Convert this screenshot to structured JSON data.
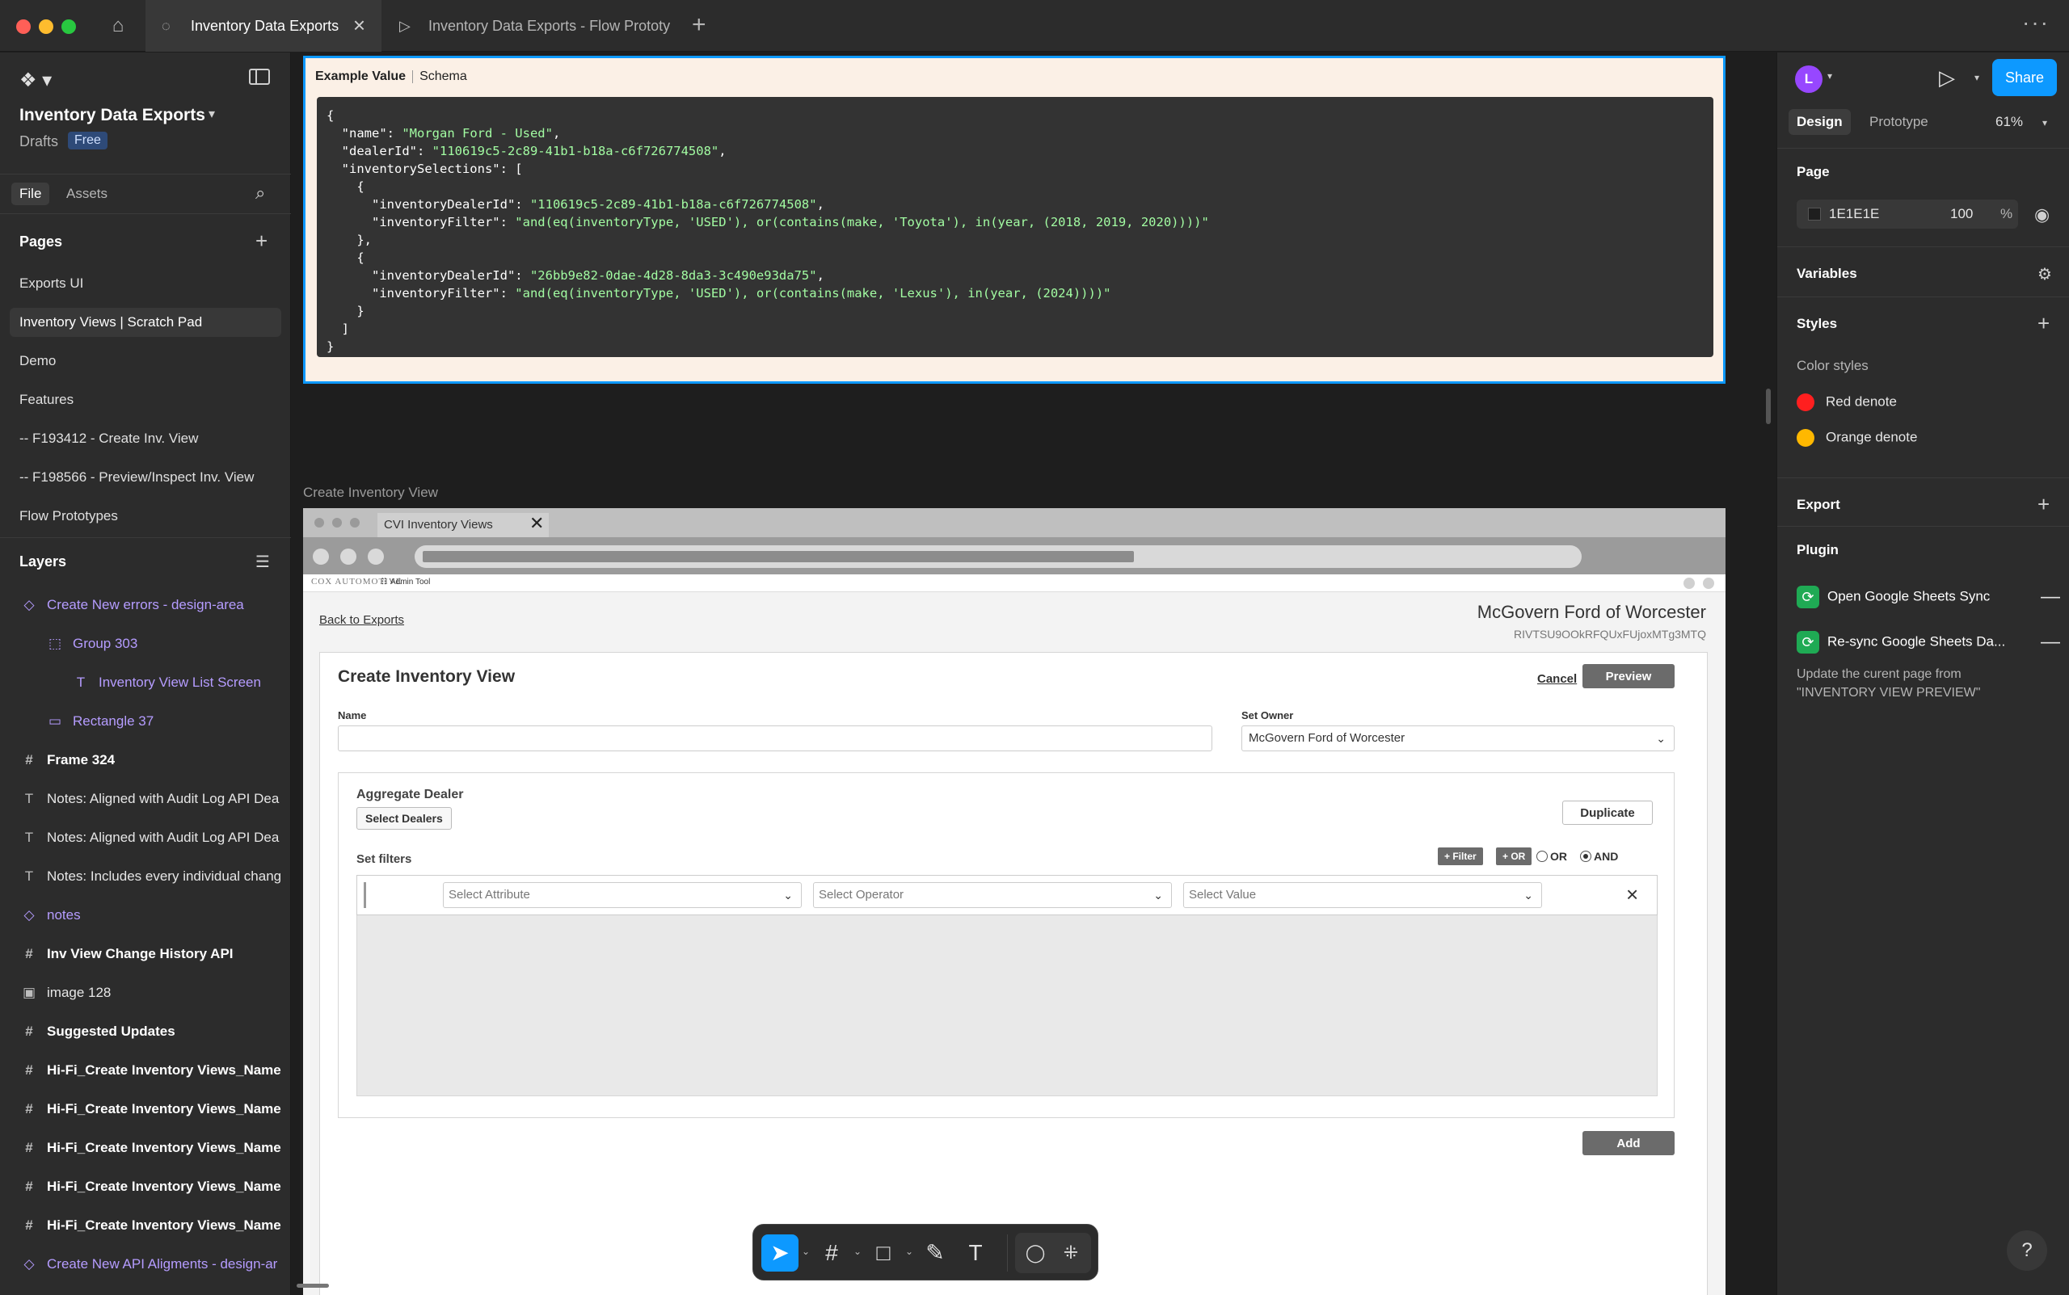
{
  "tabs": {
    "tab1": "Inventory Data Exports",
    "tab2": "Inventory Data Exports - Flow Prototy"
  },
  "file": {
    "title": "Inventory Data Exports",
    "location": "Drafts",
    "plan": "Free"
  },
  "left_tabs": {
    "file": "File",
    "assets": "Assets"
  },
  "pages": {
    "heading": "Pages",
    "items": [
      "Exports UI",
      "Inventory Views | Scratch Pad",
      "Demo",
      "Features",
      "-- F193412 - Create Inv. View",
      "-- F198566 - Preview/Inspect Inv. View",
      "Flow Prototypes"
    ]
  },
  "layers": {
    "heading": "Layers",
    "items": [
      "Create New errors - design-area",
      "Group 303",
      "Inventory View List Screen",
      "Rectangle 37",
      "Frame 324",
      "Notes: Aligned with Audit Log API Dea",
      "Notes: Aligned with Audit Log API Dea",
      "Notes: Includes every individual chang",
      "notes",
      "Inv View Change History API",
      "image 128",
      "Suggested Updates",
      "Hi-Fi_Create Inventory Views_Name",
      "Hi-Fi_Create Inventory Views_Name",
      "Hi-Fi_Create Inventory Views_Name",
      "Hi-Fi_Create Inventory Views_Name",
      "Hi-Fi_Create Inventory Views_Name",
      "Create New API Aligments - design-ar"
    ]
  },
  "example": {
    "tab_value": "Example Value",
    "tab_schema": "Schema",
    "name_value": "\"Morgan Ford - Used\"",
    "dealer_id_value": "\"110619c5-2c89-41b1-b18a-c6f726774508\"",
    "sel1_dealer": "\"110619c5-2c89-41b1-b18a-c6f726774508\"",
    "sel1_filter": "\"and(eq(inventoryType, 'USED'), or(contains(make, 'Toyota'), in(year, (2018, 2019, 2020))))\"",
    "sel2_dealer": "\"26bb9e82-0dae-4d28-8da3-3c490e93da75\"",
    "sel2_filter": "\"and(eq(inventoryType, 'USED'), or(contains(make, 'Lexus'), in(year, (2024))))\""
  },
  "mock": {
    "frame_label": "Create Inventory View",
    "browser_tab": "CVI Inventory Views",
    "brand": "COX AUTOMOTIVE",
    "app_name": "Admin Tool",
    "back_link": "Back to Exports",
    "dealer_name": "McGovern Ford of Worcester",
    "dealer_id": "RIVTSU9OOkRFQUxFUjoxMTg3MTQ",
    "form_title": "Create Inventory View",
    "cancel": "Cancel",
    "preview": "Preview",
    "name_label": "Name",
    "owner_label": "Set Owner",
    "owner_value": "McGovern Ford of Worcester",
    "agg_label": "Aggregate Dealer",
    "select_dealers": "Select Dealers",
    "duplicate": "Duplicate",
    "set_filters": "Set filters",
    "chip_filter": "+ Filter",
    "chip_or": "+ OR",
    "radio_or": "OR",
    "radio_and": "AND",
    "select_attribute": "Select Attribute",
    "select_operator": "Select Operator",
    "select_value": "Select Value",
    "add": "Add"
  },
  "right": {
    "avatar": "L",
    "share": "Share",
    "tab_design": "Design",
    "tab_prototype": "Prototype",
    "zoom": "61%",
    "page_heading": "Page",
    "page_hex": "1E1E1E",
    "page_alpha": "100",
    "page_pct": "%",
    "variables": "Variables",
    "styles": "Styles",
    "color_styles": "Color styles",
    "style1": "Red denote",
    "style2": "Orange denote",
    "export": "Export",
    "plugin": "Plugin",
    "plugin1": "Open Google Sheets Sync",
    "plugin2": "Re-sync Google Sheets Da...",
    "plugin_desc": "Update the curent page from \"INVENTORY VIEW PREVIEW\"",
    "help": "?"
  },
  "colors": {
    "accent": "#0d99ff",
    "red_denote": "#ff1f1f",
    "orange_denote": "#ffb800",
    "canvas_bg": "#1E1E1E"
  }
}
